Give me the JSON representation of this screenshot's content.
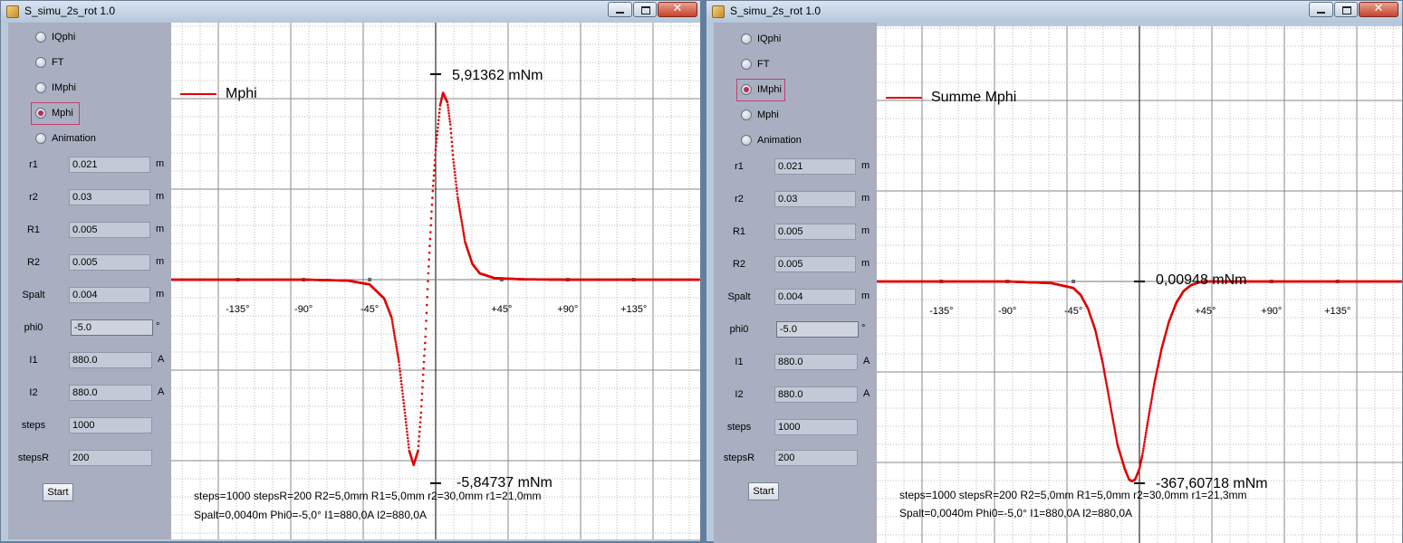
{
  "windows": [
    {
      "title": "S_simu_2s_rot 1.0",
      "radios": [
        {
          "label": "IQphi",
          "selected": false
        },
        {
          "label": "FT",
          "selected": false
        },
        {
          "label": "IMphi",
          "selected": false
        },
        {
          "label": "Mphi",
          "selected": true
        },
        {
          "label": "Animation",
          "selected": false
        }
      ],
      "fields": [
        {
          "label": "r1",
          "value": "0.021",
          "unit": "m"
        },
        {
          "label": "r2",
          "value": "0.03",
          "unit": "m"
        },
        {
          "label": "R1",
          "value": "0.005",
          "unit": "m"
        },
        {
          "label": "R2",
          "value": "0.005",
          "unit": "m"
        },
        {
          "label": "Spalt",
          "value": "0.004",
          "unit": "m"
        },
        {
          "label": "phi0",
          "value": "-5.0",
          "unit": "°"
        },
        {
          "label": "I1",
          "value": "880.0",
          "unit": "A"
        },
        {
          "label": "I2",
          "value": "880.0",
          "unit": "A"
        },
        {
          "label": "steps",
          "value": "1000",
          "unit": ""
        },
        {
          "label": "stepsR",
          "value": "200",
          "unit": ""
        }
      ],
      "start_label": "Start",
      "legend": "Mphi",
      "max_label": "5,91362 mNm",
      "min_label": "-5,84737 mNm",
      "info_line1": "steps=1000 stepsR=200 R2=5,0mm R1=5,0mm  r2=30,0mm r1=21,0mm",
      "info_line2": "Spalt=0,0040m Phi0=-5,0° I1=880,0A I2=880,0A",
      "series_color": "#e00000"
    },
    {
      "title": "S_simu_2s_rot 1.0",
      "radios": [
        {
          "label": "IQphi",
          "selected": false
        },
        {
          "label": "FT",
          "selected": false
        },
        {
          "label": "IMphi",
          "selected": true
        },
        {
          "label": "Mphi",
          "selected": false
        },
        {
          "label": "Animation",
          "selected": false
        }
      ],
      "fields": [
        {
          "label": "r1",
          "value": "0.021",
          "unit": "m"
        },
        {
          "label": "r2",
          "value": "0.03",
          "unit": "m"
        },
        {
          "label": "R1",
          "value": "0.005",
          "unit": "m"
        },
        {
          "label": "R2",
          "value": "0.005",
          "unit": "m"
        },
        {
          "label": "Spalt",
          "value": "0.004",
          "unit": "m"
        },
        {
          "label": "phi0",
          "value": "-5.0",
          "unit": "°"
        },
        {
          "label": "I1",
          "value": "880.0",
          "unit": "A"
        },
        {
          "label": "I2",
          "value": "880.0",
          "unit": "A"
        },
        {
          "label": "steps",
          "value": "1000",
          "unit": ""
        },
        {
          "label": "stepsR",
          "value": "200",
          "unit": ""
        }
      ],
      "start_label": "Start",
      "legend": "Summe Mphi",
      "max_label": "0,00948 mNm",
      "min_label": "-367,60718 mNm",
      "info_line1": "steps=1000 stepsR=200 R2=5,0mm R1=5,0mm  r2=30,0mm r1=21,3mm",
      "info_line2": "Spalt=0,0040m Phi0=-5,0° I1=880,0A I2=880,0A",
      "series_color": "#e00000"
    }
  ],
  "chart_data": [
    {
      "type": "scatter",
      "series": [
        {
          "name": "Mphi",
          "x": [
            -180,
            -90,
            -60,
            -45,
            -35,
            -30,
            -25,
            -22,
            -20,
            -18,
            -15,
            -12,
            -10,
            -7,
            -5,
            -2,
            0,
            3,
            5,
            8,
            10,
            12,
            15,
            20,
            25,
            30,
            40,
            60,
            90,
            180
          ],
          "y": [
            0,
            0,
            -0.03,
            -0.15,
            -0.6,
            -1.2,
            -2.6,
            -3.8,
            -4.6,
            -5.4,
            -5.85,
            -5.4,
            -4.2,
            -1.8,
            0.2,
            2.8,
            4.1,
            5.5,
            5.9,
            5.6,
            4.9,
            3.8,
            2.6,
            1.2,
            0.5,
            0.2,
            0.05,
            0.01,
            0,
            0
          ]
        }
      ],
      "x_ticks": [
        "-135°",
        "-90°",
        "-45°",
        "+45°",
        "+90°",
        "+135°"
      ],
      "xlim": [
        -180,
        180
      ],
      "max_label": "5,91362 mNm",
      "min_label": "-5,84737 mNm",
      "grid": true
    },
    {
      "type": "scatter",
      "series": [
        {
          "name": "Summe Mphi",
          "x": [
            -180,
            -90,
            -60,
            -45,
            -40,
            -35,
            -30,
            -25,
            -20,
            -15,
            -10,
            -7,
            -5,
            -3,
            0,
            2,
            5,
            10,
            15,
            20,
            25,
            30,
            35,
            40,
            45,
            60,
            90,
            180
          ],
          "y": [
            0,
            0,
            -3,
            -12,
            -25,
            -50,
            -90,
            -150,
            -225,
            -300,
            -345,
            -365,
            -367.6,
            -365,
            -345,
            -320,
            -270,
            -190,
            -125,
            -75,
            -40,
            -18,
            -7,
            -2,
            0,
            0,
            0,
            0
          ]
        }
      ],
      "x_ticks": [
        "-135°",
        "-90°",
        "-45°",
        "+45°",
        "+90°",
        "+135°"
      ],
      "xlim": [
        -180,
        180
      ],
      "max_label": "0,00948 mNm",
      "min_label": "-367,60718 mNm",
      "grid": true
    }
  ]
}
